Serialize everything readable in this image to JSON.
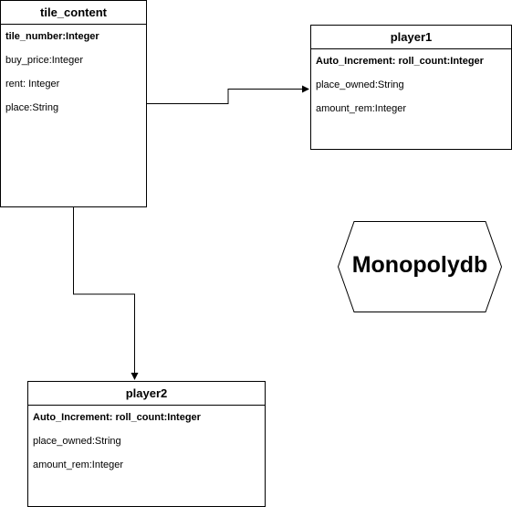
{
  "diagram": {
    "entities": {
      "tile_content": {
        "title": "tile_content",
        "fields": [
          "tile_number:Integer",
          "buy_price:Integer",
          "rent: Integer",
          "place:String"
        ]
      },
      "player1": {
        "title": "player1",
        "fields": [
          "Auto_Increment: roll_count:Integer",
          "place_owned:String",
          "amount_rem:Integer"
        ]
      },
      "player2": {
        "title": "player2",
        "fields": [
          "Auto_Increment: roll_count:Integer",
          "place_owned:String",
          "amount_rem:Integer"
        ]
      }
    },
    "database_label": "Monopolydb",
    "connections": [
      {
        "from": "tile_content",
        "to": "player1"
      },
      {
        "from": "tile_content",
        "to": "player2"
      }
    ]
  }
}
